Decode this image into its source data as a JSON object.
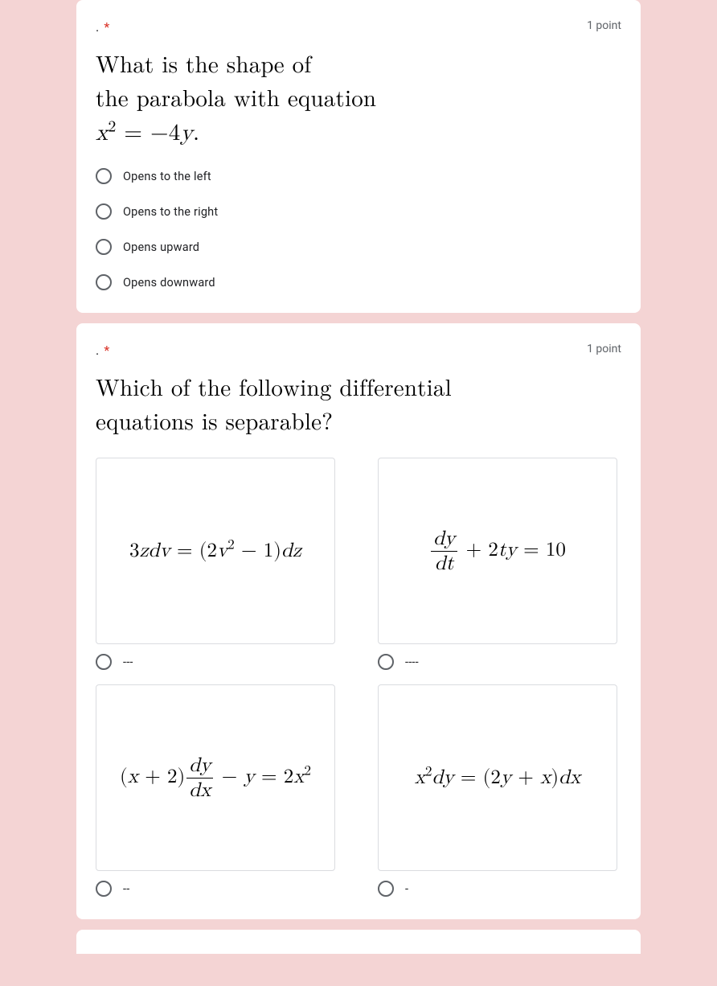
{
  "q1": {
    "marker": ".",
    "required": "*",
    "points": "1 point",
    "mathLine1": "What is the shape of",
    "mathLine2": "the parabola with equation",
    "options": [
      "Opens to the left",
      "Opens to the right",
      "Opens upward",
      "Opens downward"
    ]
  },
  "q2": {
    "marker": ".",
    "required": "*",
    "points": "1 point",
    "mathLine1": "Which of the following differential",
    "mathLine2": "equations is separable?",
    "radios": [
      "---",
      "----",
      "--",
      "-"
    ]
  }
}
